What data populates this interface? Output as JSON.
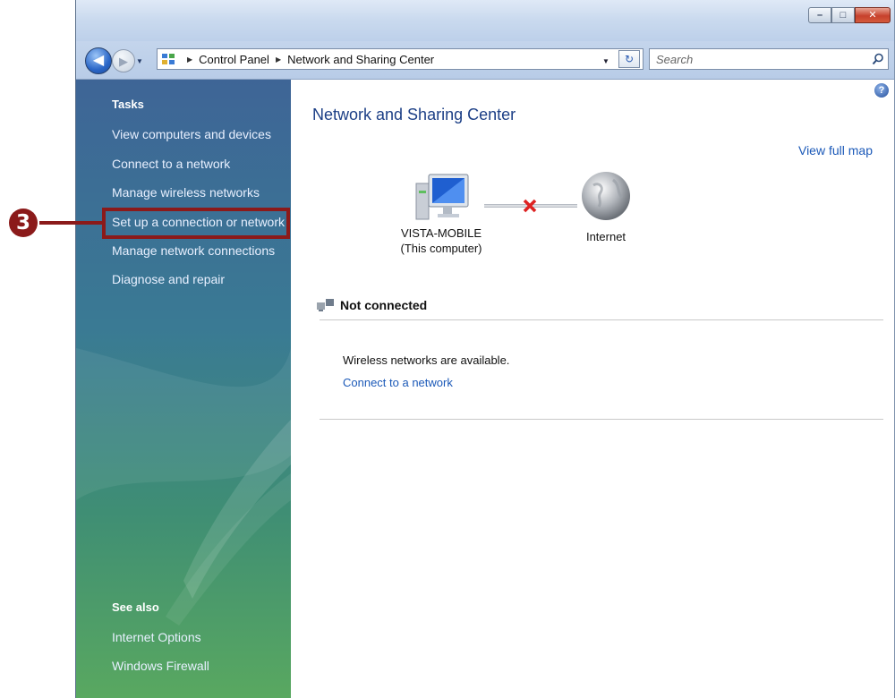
{
  "window": {
    "controls": {
      "minimize": "–",
      "maximize": "□",
      "close": "✕"
    }
  },
  "navbar": {
    "breadcrumb": [
      "Control Panel",
      "Network and Sharing Center"
    ],
    "search_placeholder": "Search"
  },
  "sidebar": {
    "tasks_heading": "Tasks",
    "tasks": [
      "View computers and devices",
      "Connect to a network",
      "Manage wireless networks",
      "Set up a connection or network",
      "Manage network connections",
      "Diagnose and repair"
    ],
    "see_also_heading": "See also",
    "see_also": [
      "Internet Options",
      "Windows Firewall"
    ]
  },
  "main": {
    "title": "Network and Sharing Center",
    "view_full_map": "View full map",
    "computer_name": "VISTA-MOBILE",
    "computer_sub": "(This computer)",
    "internet_label": "Internet",
    "status_heading": "Not connected",
    "wireless_text": "Wireless networks are available.",
    "connect_link": "Connect to a network"
  },
  "callout": {
    "number": "3"
  },
  "colors": {
    "callout": "#8b1a1a",
    "link": "#1b59b8",
    "title": "#1c3f86"
  }
}
